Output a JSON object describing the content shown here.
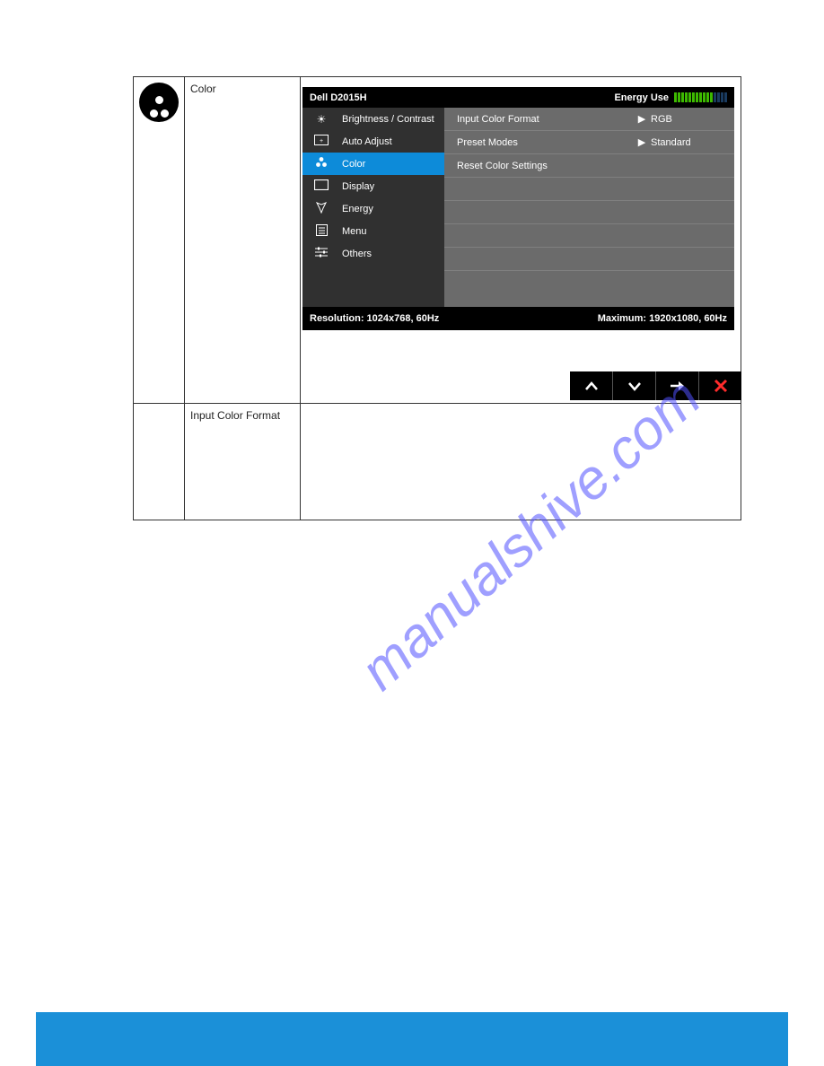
{
  "doc": {
    "row1": {
      "label": "Color"
    },
    "row2": {
      "label": "Input Color Format"
    }
  },
  "osd": {
    "title": "Dell D2015H",
    "energy_label": "Energy Use",
    "nav": [
      {
        "label": "Brightness / Contrast"
      },
      {
        "label": "Auto Adjust"
      },
      {
        "label": "Color"
      },
      {
        "label": "Display"
      },
      {
        "label": "Energy"
      },
      {
        "label": "Menu"
      },
      {
        "label": "Others"
      }
    ],
    "right": [
      {
        "label": "Input Color Format",
        "arrow": true,
        "value": "RGB"
      },
      {
        "label": "Preset Modes",
        "arrow": true,
        "value": "Standard"
      },
      {
        "label": "Reset Color Settings",
        "arrow": false,
        "value": ""
      }
    ],
    "footer_left": "Resolution: 1024x768, 60Hz",
    "footer_right": "Maximum: 1920x1080, 60Hz"
  },
  "watermark": "manualshive.com"
}
